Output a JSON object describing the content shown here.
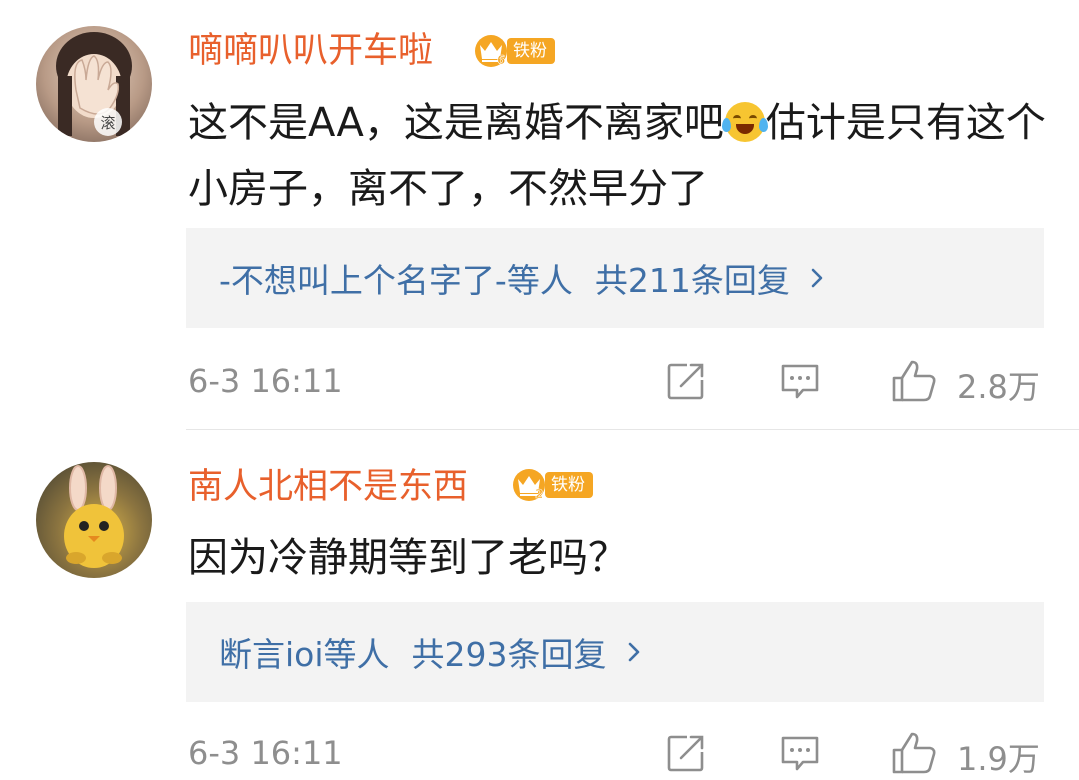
{
  "comments": [
    {
      "username": "嘀嘀叭叭开车啦",
      "badge_level": "6",
      "badge_label": "铁粉",
      "avatar_caption": "滚",
      "text_part1": "这不是AA，这是离婚不离家吧",
      "emoji": "laugh-cry-emoji",
      "text_part2": "估计是只有这个小房子，离不了，不然早分了",
      "reply_names": "-不想叫上个名字了-等人",
      "reply_total": "共211条回复",
      "time": "6-3 16:11",
      "likes": "2.8万"
    },
    {
      "username": "南人北相不是东西",
      "badge_level": "2",
      "badge_label": "铁粉",
      "text": "因为冷静期等到了老吗？",
      "reply_names": "断言ioi等人",
      "reply_total": "共293条回复",
      "time": "6-3 16:11",
      "likes": "1.9万"
    }
  ],
  "icons": {
    "share": "share-icon",
    "comment": "comment-icon",
    "like": "thumbs-up-icon",
    "arrow": "chevron-right-icon"
  },
  "colors": {
    "username": "#e8602c",
    "reply_link": "#3f6fa6",
    "badge": "#f5a623",
    "meta": "#8e8e8e",
    "reply_bg": "#f3f3f3"
  }
}
